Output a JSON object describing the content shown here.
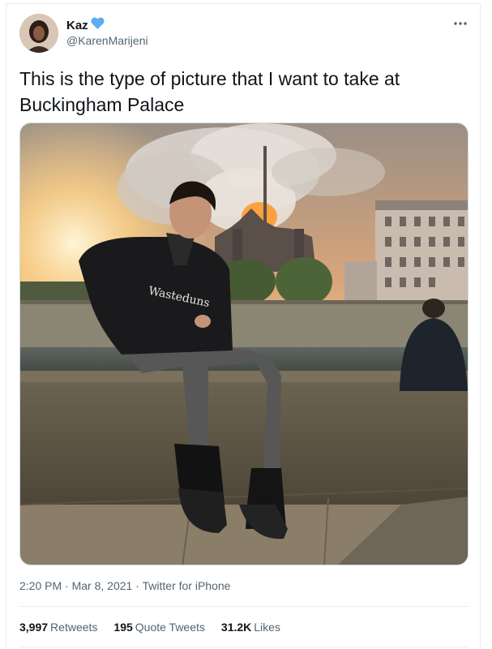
{
  "user": {
    "display_name": "Kaz",
    "handle": "@KarenMarijeni",
    "badge_icon": "blue-heart-icon"
  },
  "tweet": {
    "text": "This is the type of picture that I want to take at Buckingham Palace",
    "more_icon": "more-horizontal-icon"
  },
  "meta": {
    "time": "2:20 PM",
    "separator1": " · ",
    "date": "Mar 8, 2021",
    "separator2": " · ",
    "source": "Twitter for iPhone"
  },
  "stats": {
    "retweets_count": "3,997",
    "retweets_label": "Retweets",
    "quotes_count": "195",
    "quotes_label": "Quote Tweets",
    "likes_count": "31.2K",
    "likes_label": "Likes"
  },
  "photo": {
    "hoodie_text": "Wasteduns"
  },
  "colors": {
    "text_primary": "#0f1419",
    "text_secondary": "#536471",
    "heart_blue": "#5daef0",
    "divider": "#e6ecf0"
  }
}
